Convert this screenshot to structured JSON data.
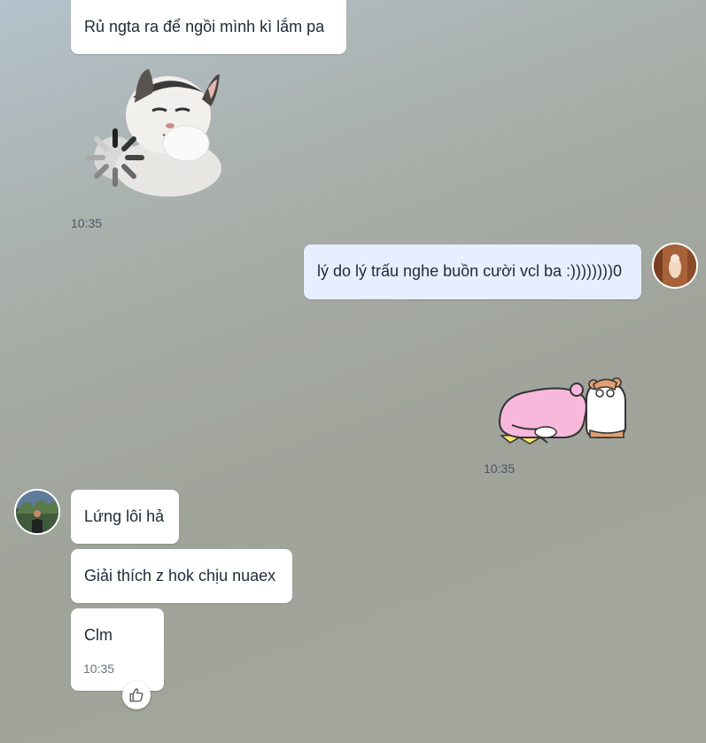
{
  "messages": {
    "m1": {
      "text": "Rủ ngta ra để ngồi mình kì lắm pa"
    },
    "m2": {
      "time": "10:35"
    },
    "m3": {
      "text": "lý do lý trấu nghe buồn cười vcl ba :))))))))0"
    },
    "m4": {
      "time": "10:35"
    },
    "m5": {
      "text": "Lứng lôi hả"
    },
    "m6": {
      "text": "Giải thích z hok chịu nuaex"
    },
    "m7": {
      "text": "Clm",
      "time": "10:35"
    }
  },
  "colors": {
    "bubble_incoming": "#ffffff",
    "bubble_outgoing": "#e5efff"
  },
  "icons": {
    "like": "thumbs-up-icon",
    "loading": "loading-spinner-icon"
  }
}
